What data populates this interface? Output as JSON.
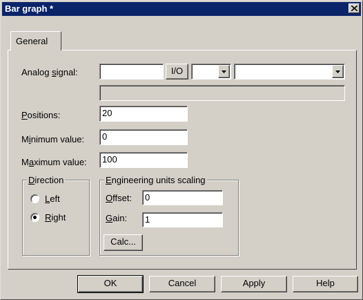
{
  "window": {
    "title": "Bar graph *",
    "colors": {
      "titlebar": "#0a246a",
      "face": "#d4d0c8"
    }
  },
  "tabs": [
    {
      "label": "General",
      "selected": true
    }
  ],
  "analog_signal": {
    "label_pre": "Analog ",
    "label_accel": "s",
    "label_post": "ignal:",
    "value": "",
    "io_button": "I/O",
    "type_value": "",
    "address_value": "",
    "description": ""
  },
  "positions": {
    "label_accel": "P",
    "label_post": "ositions:",
    "value": "20"
  },
  "minimum": {
    "label_pre": "M",
    "label_accel": "i",
    "label_post": "nimum value:",
    "value": "0"
  },
  "maximum": {
    "label_pre": "M",
    "label_accel": "a",
    "label_post": "ximum value:",
    "value": "100"
  },
  "direction": {
    "legend_accel": "D",
    "legend_post": "irection",
    "left": {
      "label_accel": "L",
      "label_post": "eft",
      "checked": false
    },
    "right": {
      "label_accel": "R",
      "label_post": "ight",
      "checked": true
    }
  },
  "scaling": {
    "legend_accel": "E",
    "legend_post": "ngineering units scaling",
    "offset": {
      "label_accel": "O",
      "label_post": "ffset:",
      "value": "0"
    },
    "gain": {
      "label_accel": "G",
      "label_post": "ain:",
      "value": "1"
    },
    "calc_button": "Calc..."
  },
  "footer": {
    "ok": "OK",
    "cancel": "Cancel",
    "apply": "Apply",
    "help": "Help"
  }
}
